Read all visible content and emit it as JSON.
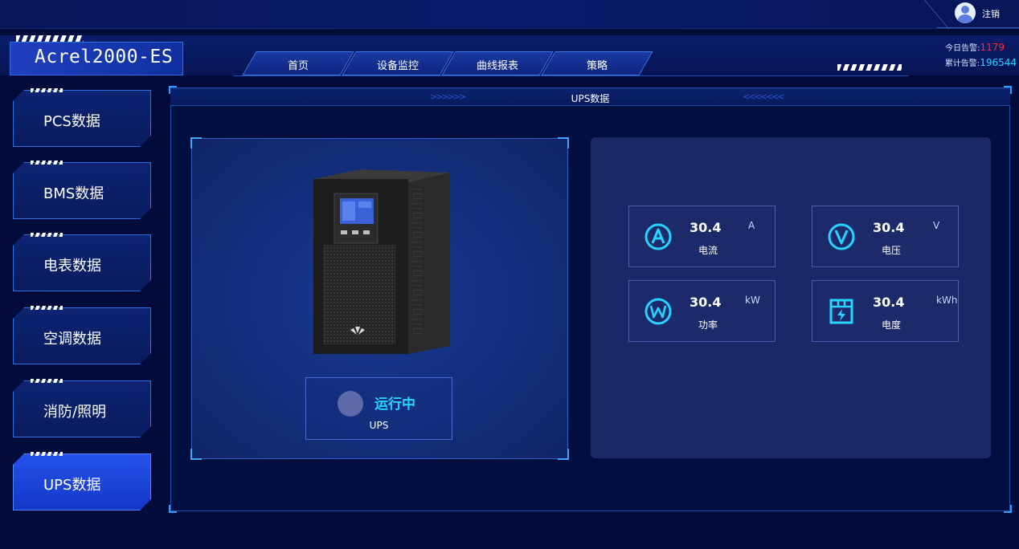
{
  "app": {
    "title": "Acrel2000-ES"
  },
  "topbar": {
    "logout_label": "注销"
  },
  "nav": {
    "tabs": [
      {
        "label": "首页"
      },
      {
        "label": "设备监控"
      },
      {
        "label": "曲线报表"
      },
      {
        "label": "策略"
      }
    ]
  },
  "alarms": {
    "today_label": "今日告警:",
    "today_value": "1179",
    "total_label": "累计告警:",
    "total_value": "196544"
  },
  "sidebar": {
    "items": [
      {
        "label": "PCS数据"
      },
      {
        "label": "BMS数据"
      },
      {
        "label": "电表数据"
      },
      {
        "label": "空调数据"
      },
      {
        "label": "消防/照明"
      },
      {
        "label": "UPS数据"
      }
    ],
    "active_index": 5
  },
  "panel": {
    "title": "UPS数据",
    "chevrons_left": ">>>>>>",
    "chevrons_right": "<<<<<<<"
  },
  "device": {
    "status_text": "运行中",
    "name": "UPS"
  },
  "metrics": [
    {
      "value": "30.4",
      "unit": "A",
      "label": "电流",
      "icon": "current-icon"
    },
    {
      "value": "30.4",
      "unit": "V",
      "label": "电压",
      "icon": "voltage-icon"
    },
    {
      "value": "30.4",
      "unit": "kW",
      "label": "功率",
      "icon": "power-icon"
    },
    {
      "value": "30.4",
      "unit": "kWh",
      "label": "电度",
      "icon": "energy-meter-icon"
    }
  ],
  "colors": {
    "background": "#020b3a",
    "accent_cyan": "#27d3ff",
    "alarm_red": "#ff2a2a",
    "active_blue": "#2552e8"
  }
}
